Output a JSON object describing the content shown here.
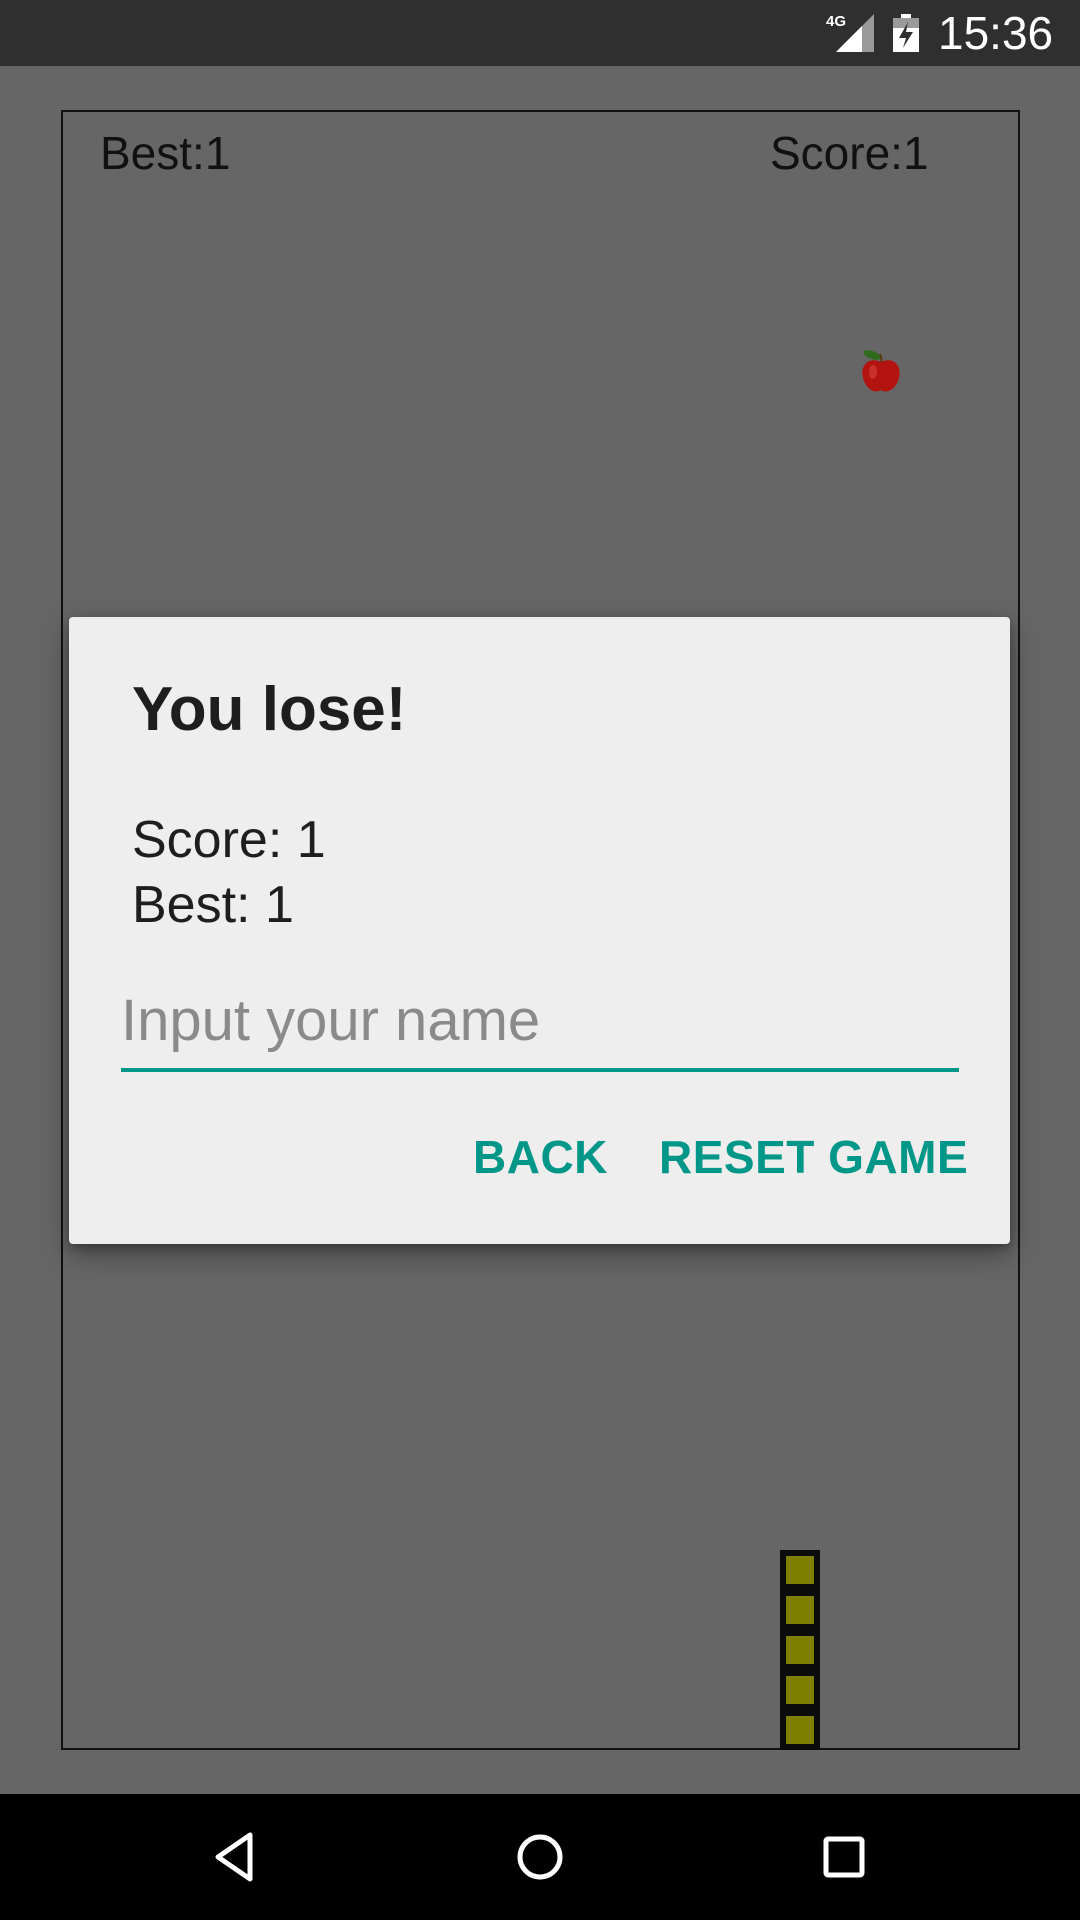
{
  "status_bar": {
    "network_label": "4G",
    "time": "15:36",
    "icons": [
      "signal-icon",
      "battery-charging-icon"
    ]
  },
  "game": {
    "best_label": "Best:1",
    "score_label": "Score:1",
    "snake_segments": 5,
    "colors": {
      "background": "#666666",
      "snake_body": "#7d7d00",
      "snake_outline": "#0b0b0b",
      "apple": "#b3140f"
    }
  },
  "dialog": {
    "title": "You lose!",
    "score_line": "Score: 1",
    "best_line": "Best: 1",
    "name_input": {
      "value": "",
      "placeholder": "Input your name"
    },
    "back_label": "BACK",
    "reset_label": "RESET GAME",
    "accent_color": "#009688"
  },
  "nav_bar": {
    "icons": [
      "back-triangle-icon",
      "home-circle-icon",
      "recents-square-icon"
    ]
  }
}
